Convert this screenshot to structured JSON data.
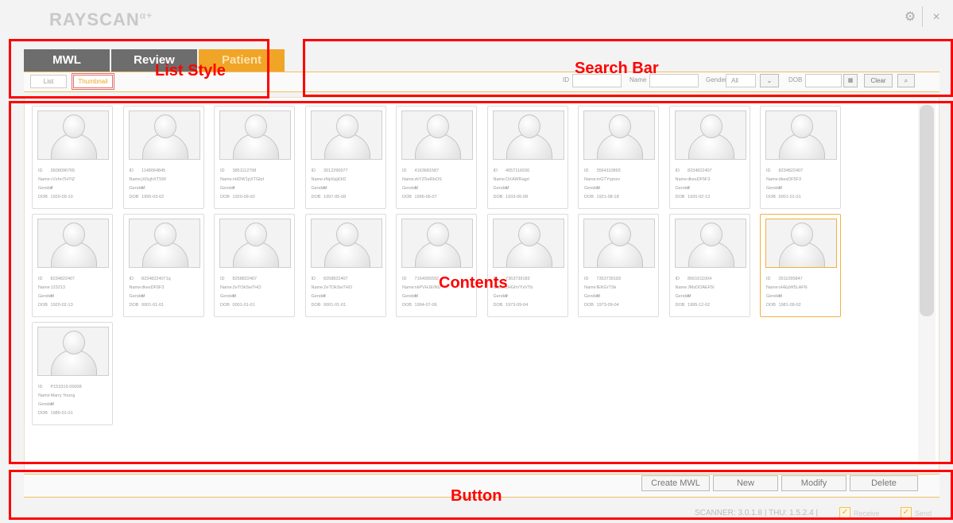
{
  "app": {
    "logo": "RAYSCAN",
    "logo_sup": "α+"
  },
  "window": {
    "settings_glyph": "⚙",
    "close_glyph": "×"
  },
  "tabs": [
    {
      "label": "MWL"
    },
    {
      "label": "Review"
    },
    {
      "label": "Patient"
    }
  ],
  "list_style": {
    "list_label": "List",
    "thumbnail_label": "Thumbnail"
  },
  "search": {
    "id_label": "ID",
    "name_label": "Name",
    "gender_label": "Gender",
    "gender_value": "All",
    "dob_label": "DOB",
    "clear_label": "Clear"
  },
  "cards": [
    {
      "id": "3608096765",
      "name": "cVzhnTHYiZ",
      "gender": "F",
      "dob": "1920-09-10"
    },
    {
      "id": "1148064845",
      "name": "jX0yjhXTSW",
      "gender": "M",
      "dob": "1995-03-02"
    },
    {
      "id": "3851112798",
      "name": "nHDW1pXTGbrl",
      "gender": "F",
      "dob": "1920-09-00"
    },
    {
      "id": "3012290077",
      "name": "zNpXpjiOiD",
      "gender": "M",
      "dob": "1997-05-08"
    },
    {
      "id": "4163681587",
      "name": "zkYZSeRbOS",
      "gender": "M",
      "dob": "1996-06-07"
    },
    {
      "id": "4657116936",
      "name": "OXAWRagrl",
      "gender": "M",
      "dob": "1933-06-08"
    },
    {
      "id": "3564110893",
      "name": "mGTYrpnev",
      "gender": "M",
      "dob": "1921-08-18"
    },
    {
      "id": "8234822407",
      "name": "dkesDF5F3",
      "gender": "F",
      "dob": "1920-02-13"
    },
    {
      "id": "8234822407",
      "name": "dkesDF5F3",
      "gender": "M",
      "dob": "0001-01-01"
    },
    {
      "id": "8234822407",
      "name": "123213",
      "gender": "M",
      "dob": "1920-02-13"
    },
    {
      "id": "82348224071q",
      "name": "dkesDF5F3",
      "gender": "M",
      "dob": "0001-01-01"
    },
    {
      "id": "8258822407",
      "name": "ZeTOkSwTHO",
      "gender": "M",
      "dob": "0001-01-01"
    },
    {
      "id": "8258822407",
      "name": "ZeTOkSwTHO",
      "gender": "F",
      "dob": "0001-01-01"
    },
    {
      "id": "7164065592",
      "name": "nkPVHJEINU",
      "gender": "M",
      "dob": "1994-07-06"
    },
    {
      "id": "7363739183",
      "name": "zHGhVYxVTb",
      "gender": "F",
      "dob": "1973-09-04"
    },
    {
      "id": "7353739183",
      "name": "fEKGrTSk",
      "gender": "M",
      "dob": "1973-09-04"
    },
    {
      "id": "8561611004",
      "name": "JMsDOAEF5I",
      "gender": "M",
      "dob": "1995-12-02"
    },
    {
      "id": "3511095847",
      "name": "oHEpW5LAFN",
      "gender": "M",
      "dob": "1981-09-02"
    },
    {
      "id": "P153315-00008",
      "name": "Marry Young",
      "gender": "M",
      "dob": "1985-01-01"
    }
  ],
  "field_labels": {
    "id": "ID",
    "name": "Name",
    "gender": "Gender",
    "dob": "DOB"
  },
  "buttons": {
    "create_mwl": "Create MWL",
    "new": "New",
    "modify": "Modify",
    "delete": "Delete"
  },
  "status": {
    "version": "SCANNER: 3.0.1.8 | THU: 1.5.2.4 |",
    "receive_label": "Receive",
    "send_label": "Send"
  },
  "annotations": {
    "list_style": "List Style",
    "search_bar": "Search Bar",
    "contents": "Contents",
    "button": "Button"
  }
}
